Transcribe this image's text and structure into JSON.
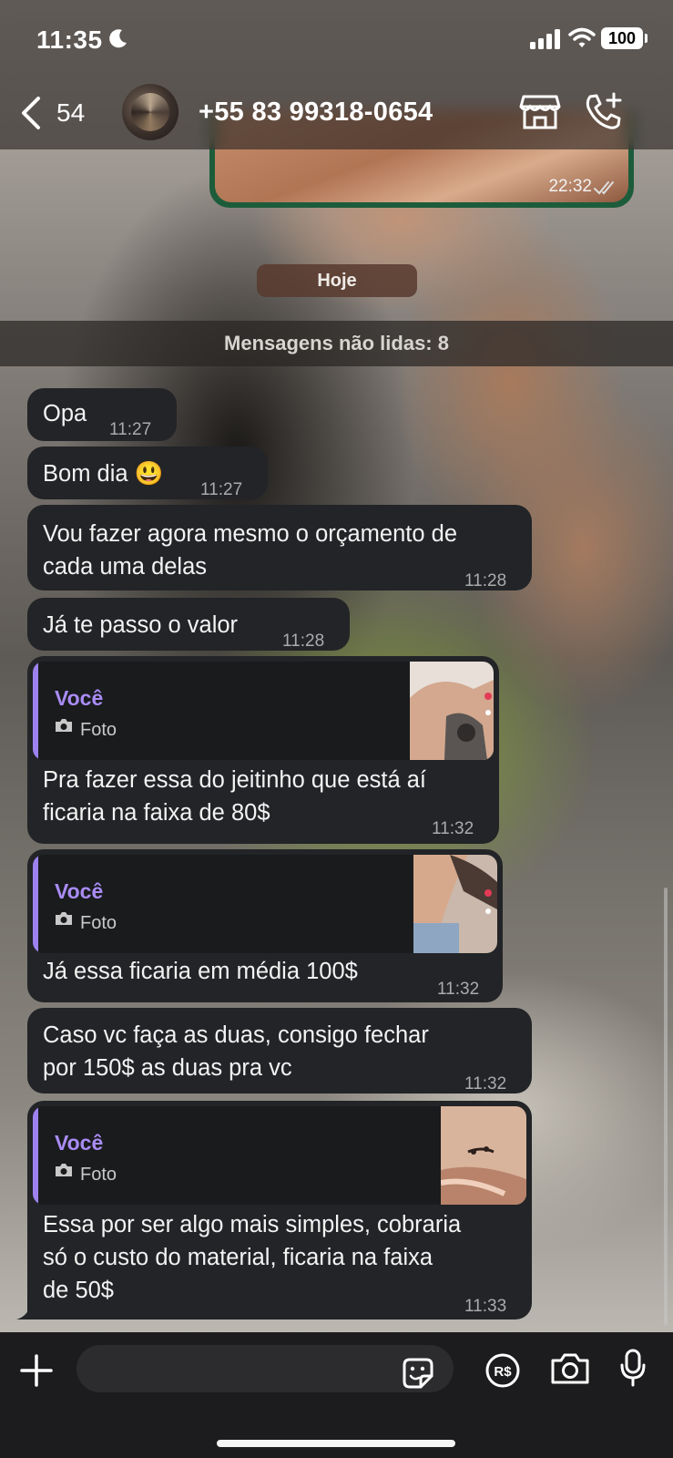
{
  "status": {
    "time": "11:35",
    "battery": "100"
  },
  "header": {
    "back_count": "54",
    "contact": "+55 83 99318-0654"
  },
  "top_message": {
    "time": "22:32"
  },
  "date_chip": "Hoje",
  "unread_banner": "Mensagens não lidas: 8",
  "messages": [
    {
      "text": "Opa",
      "time": "11:27"
    },
    {
      "text": "Bom dia 😃",
      "time": "11:27"
    },
    {
      "line1": "Vou fazer agora mesmo o orçamento de",
      "line2": "cada uma delas",
      "time": "11:28"
    },
    {
      "text": "Já te passo o valor",
      "time": "11:28"
    },
    {
      "reply_author": "Você",
      "reply_type": "Foto",
      "line1": "Pra fazer essa do jeitinho que está aí",
      "line2": "ficaria na faixa de 80$",
      "time": "11:32"
    },
    {
      "reply_author": "Você",
      "reply_type": "Foto",
      "text": "Já essa ficaria em média 100$",
      "time": "11:32"
    },
    {
      "line1": "Caso vc faça as duas, consigo fechar",
      "line2": "por 150$ as duas pra vc",
      "time": "11:32"
    },
    {
      "reply_author": "Você",
      "reply_type": "Foto",
      "line1": "Essa por ser algo mais simples, cobraria",
      "line2": "só o custo do material, ficaria na faixa",
      "line3": "de 50$",
      "time": "11:33"
    }
  ],
  "colors": {
    "incoming_bubble": "#222427",
    "outgoing_bubble": "#1d5c3b",
    "reply_accent": "#a98cf5"
  },
  "icons": [
    "moon-icon",
    "signal-icon",
    "wifi-icon",
    "back-icon",
    "store-icon",
    "add-call-icon",
    "plus-icon",
    "sticker-icon",
    "pix-icon",
    "camera-icon",
    "mic-icon"
  ]
}
